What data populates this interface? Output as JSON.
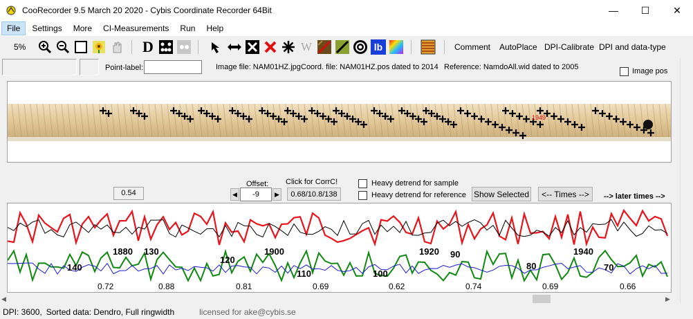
{
  "window": {
    "title": "CooRecorder 9.5 March 20 2020 - Cybis Coordinate Recorder  64Bit",
    "minimize": "—",
    "maximize": "☐",
    "close": "✕"
  },
  "menu": [
    "File",
    "Settings",
    "More",
    "CI-Measurements",
    "Run",
    "Help"
  ],
  "toolbar": {
    "zoom": "5%",
    "d_label": "D",
    "comment": "Comment",
    "autoplace": "AutoPlace",
    "dpi_calibrate": "DPI-Calibrate",
    "dpi_datatype": "DPI and data-type",
    "lb_label": "lb"
  },
  "info": {
    "point_label": "Point-label:",
    "point_value": "",
    "image_file": "Image file: NAM01HZ.jpg",
    "coord_file": "Coord. file: NAM01HZ.pos dated to 2014",
    "reference": "Reference: NamdoAll.wid dated to 2005",
    "image_pos": "Image pos"
  },
  "controls": {
    "corr_value": "0.54",
    "offset_label": "Offset:",
    "offset_value": "-9",
    "click_corrc": "Click for CorrC!",
    "corrc_value": "0.68/10.8/138",
    "heavy_sample": "Heavy detrend for sample",
    "heavy_reference": "Heavy detrend for reference",
    "show_selected": "Show Selected",
    "times_button": "<-- Times -->",
    "later_times": "--> later times -->"
  },
  "graph": {
    "series_colors": {
      "sample": "#e8141c",
      "reference": "#000000",
      "green": "#118811",
      "blue": "#1a1ad0"
    },
    "year_labels": [
      {
        "text": "140"
      },
      {
        "text": "1880"
      },
      {
        "text": "130"
      },
      {
        "text": "120"
      },
      {
        "text": "1900"
      },
      {
        "text": "110"
      },
      {
        "text": "100"
      },
      {
        "text": "1920"
      },
      {
        "text": "90"
      },
      {
        "text": "80"
      },
      {
        "text": "1940"
      },
      {
        "text": "70"
      }
    ],
    "corr_labels": [
      "0.72",
      "0.88",
      "0.81",
      "0.69",
      "0.62",
      "0.74",
      "0.69",
      "0.66"
    ]
  },
  "status": {
    "dpi": "DPI: 3600,",
    "sorted": "Sorted data: Dendro, Full ringwidth",
    "license": "licensed for ake@cybis.se"
  }
}
